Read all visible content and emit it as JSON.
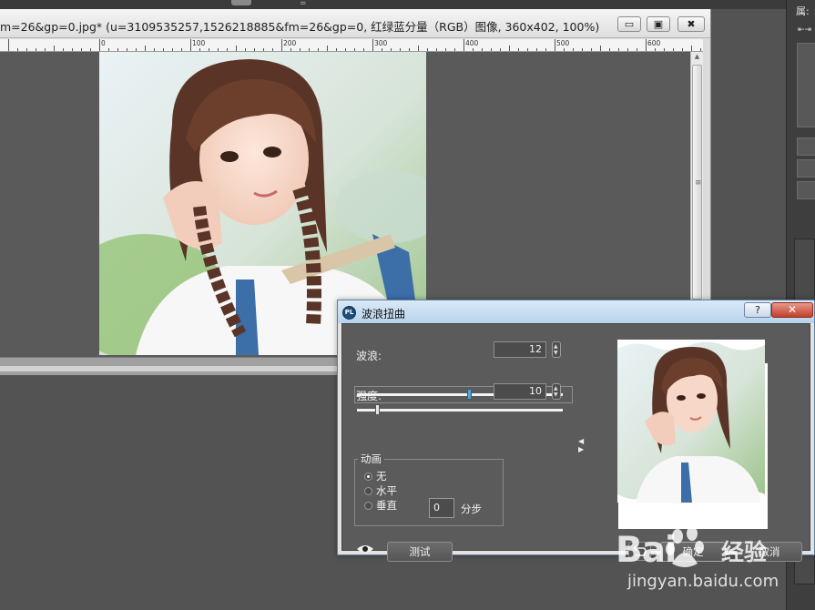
{
  "app": {
    "document_title": "m=26&gp=0.jpg* (u=3109535257,1526218885&fm=26&gp=0, 红绿蓝分量（RGB）图像, 360x402, 100%)",
    "window_buttons": {
      "minimize": "▭",
      "maximize": "▣",
      "close": "✖"
    },
    "top_marker": "="
  },
  "ruler": {
    "labels": [
      "0",
      "100",
      "200",
      "300",
      "400",
      "500",
      "600"
    ]
  },
  "right_panel": {
    "label": "属:",
    "arrow": "⇤⇥"
  },
  "dialog": {
    "title": "波浪扭曲",
    "icon_text": "PL",
    "help_label": "?",
    "close_label": "✕",
    "wave": {
      "label": "波浪:",
      "value": "12",
      "fraction": 0.55
    },
    "strength": {
      "label": "强度:",
      "value": "10",
      "fraction": 0.1
    },
    "animation": {
      "legend": "动画",
      "options": [
        {
          "label": "无",
          "selected": true
        },
        {
          "label": "水平",
          "selected": false
        },
        {
          "label": "垂直",
          "selected": false
        }
      ],
      "steps_value": "0",
      "steps_label": "分步"
    },
    "buttons": {
      "test": "测试",
      "ok": "确定",
      "cancel": "取消"
    }
  },
  "watermark": {
    "brand": "Bai",
    "brand_cn": "经验",
    "url": "jingyan.baidu.com"
  },
  "colors": {
    "accent": "#4aa8d8",
    "dialog_body": "#5b5b5b",
    "workspace": "#535353"
  }
}
